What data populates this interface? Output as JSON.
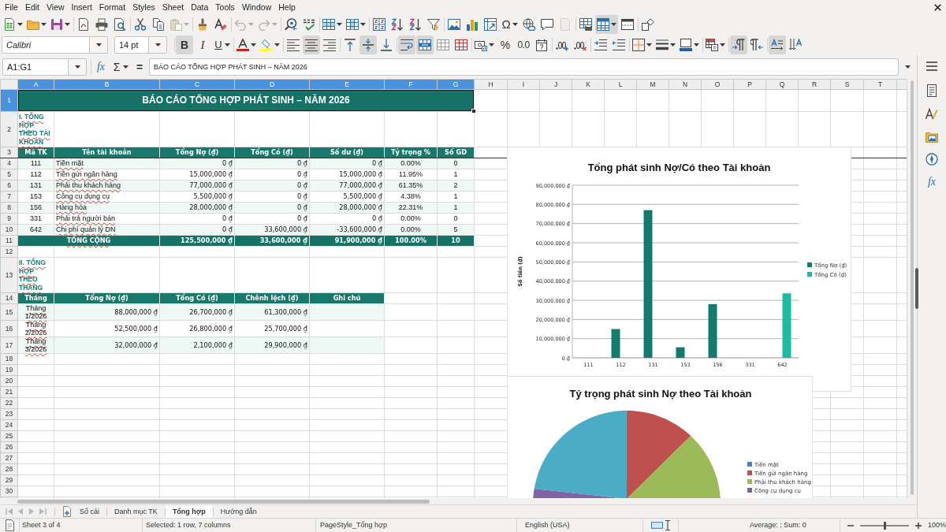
{
  "menu_bar": {
    "items": [
      "File",
      "Edit",
      "View",
      "Insert",
      "Format",
      "Styles",
      "Sheet",
      "Data",
      "Tools",
      "Window",
      "Help"
    ]
  },
  "standard_toolbar": {
    "groups": [
      [
        {
          "kind": "new",
          "dropdown": true,
          "pressed": false,
          "disabled": false
        },
        {
          "kind": "open",
          "dropdown": true,
          "pressed": false,
          "disabled": false
        },
        {
          "kind": "save",
          "dropdown": true,
          "pressed": false,
          "disabled": false
        }
      ],
      [
        {
          "kind": "export_pdf",
          "dropdown": false,
          "pressed": false,
          "disabled": false
        },
        {
          "kind": "print",
          "dropdown": false,
          "pressed": false,
          "disabled": false
        },
        {
          "kind": "print_preview",
          "dropdown": false,
          "pressed": false,
          "disabled": false
        }
      ],
      [
        {
          "kind": "cut",
          "dropdown": false,
          "pressed": false,
          "disabled": false
        },
        {
          "kind": "copy",
          "dropdown": false,
          "pressed": false,
          "disabled": false
        },
        {
          "kind": "paste",
          "dropdown": true,
          "pressed": false,
          "disabled": true
        }
      ],
      [
        {
          "kind": "clone_formatting",
          "dropdown": false,
          "pressed": false,
          "disabled": false
        },
        {
          "kind": "clear_formatting",
          "dropdown": false,
          "pressed": false,
          "disabled": false
        }
      ],
      [
        {
          "kind": "undo",
          "dropdown": true,
          "pressed": false,
          "disabled": true
        },
        {
          "kind": "redo",
          "dropdown": true,
          "pressed": false,
          "disabled": true
        }
      ],
      [
        {
          "kind": "find_replace",
          "dropdown": false,
          "pressed": false,
          "disabled": false
        },
        {
          "kind": "spelling",
          "dropdown": false,
          "pressed": false,
          "disabled": false
        }
      ],
      [
        {
          "kind": "rows",
          "dropdown": true,
          "pressed": false,
          "disabled": false
        },
        {
          "kind": "columns",
          "dropdown": true,
          "pressed": false,
          "disabled": false
        }
      ],
      [
        {
          "kind": "sort",
          "dropdown": false,
          "pressed": false,
          "disabled": false
        },
        {
          "kind": "sort_ascending",
          "dropdown": false,
          "pressed": false,
          "disabled": false
        },
        {
          "kind": "sort_descending",
          "dropdown": false,
          "pressed": false,
          "disabled": false
        },
        {
          "kind": "autofilter",
          "dropdown": false,
          "pressed": false,
          "disabled": false
        }
      ],
      [
        {
          "kind": "image",
          "dropdown": false,
          "pressed": false,
          "disabled": false
        },
        {
          "kind": "chart",
          "dropdown": false,
          "pressed": false,
          "disabled": false
        },
        {
          "kind": "pivot_table",
          "dropdown": false,
          "pressed": false,
          "disabled": false
        },
        {
          "kind": "special_character",
          "label": "Ω",
          "dropdown": true,
          "pressed": false,
          "disabled": false
        },
        {
          "kind": "hyperlink",
          "dropdown": false,
          "pressed": false,
          "disabled": false
        },
        {
          "kind": "comment",
          "dropdown": false,
          "pressed": false,
          "disabled": false
        },
        {
          "kind": "header_footer",
          "dropdown": false,
          "pressed": false,
          "disabled": true
        }
      ],
      [
        {
          "kind": "print_area",
          "dropdown": false,
          "pressed": false,
          "disabled": false
        },
        {
          "kind": "freeze",
          "dropdown": true,
          "pressed": true,
          "disabled": false
        },
        {
          "kind": "split_window",
          "dropdown": false,
          "pressed": false,
          "disabled": false
        }
      ],
      [
        {
          "kind": "shapes",
          "dropdown": false,
          "pressed": false,
          "disabled": false
        }
      ]
    ]
  },
  "formatting_toolbar": {
    "font_name": "Calibri",
    "font_size": "14 pt",
    "groups": [
      [
        {
          "kind": "bold",
          "label": "B",
          "dropdown": false,
          "pressed": true,
          "disabled": false
        },
        {
          "kind": "italic",
          "label": "I",
          "dropdown": false,
          "pressed": false,
          "disabled": false
        },
        {
          "kind": "underline",
          "label": "U",
          "dropdown": true,
          "pressed": false,
          "disabled": false
        }
      ],
      [
        {
          "kind": "font_color",
          "dropdown": true,
          "pressed": false,
          "disabled": false
        },
        {
          "kind": "highlighting",
          "dropdown": true,
          "pressed": false,
          "disabled": false
        }
      ],
      [
        {
          "kind": "align_left",
          "dropdown": false,
          "pressed": false,
          "disabled": false
        },
        {
          "kind": "align_center",
          "dropdown": false,
          "pressed": true,
          "disabled": false
        },
        {
          "kind": "align_right",
          "dropdown": false,
          "pressed": false,
          "disabled": false
        }
      ],
      [
        {
          "kind": "align_top",
          "dropdown": false,
          "pressed": false,
          "disabled": false
        },
        {
          "kind": "align_middle",
          "dropdown": false,
          "pressed": true,
          "disabled": false
        },
        {
          "kind": "align_bottom",
          "dropdown": false,
          "pressed": false,
          "disabled": false
        }
      ],
      [
        {
          "kind": "wrap_text",
          "dropdown": false,
          "pressed": true,
          "disabled": false
        },
        {
          "kind": "merge_and_center",
          "dropdown": false,
          "pressed": true,
          "disabled": false
        },
        {
          "kind": "merge_cells",
          "dropdown": false,
          "pressed": false,
          "disabled": false
        },
        {
          "kind": "unmerge_cells",
          "dropdown": false,
          "pressed": false,
          "disabled": false
        }
      ],
      [
        {
          "kind": "currency",
          "dropdown": true,
          "pressed": false,
          "disabled": false
        },
        {
          "kind": "percent",
          "label": "%",
          "dropdown": false,
          "pressed": false,
          "disabled": false
        },
        {
          "kind": "number",
          "label": "0.0",
          "dropdown": false,
          "pressed": false,
          "disabled": false
        },
        {
          "kind": "date",
          "dropdown": false,
          "pressed": false,
          "disabled": false
        }
      ],
      [
        {
          "kind": "add_decimal",
          "dropdown": false,
          "pressed": false,
          "disabled": false
        },
        {
          "kind": "delete_decimal",
          "dropdown": false,
          "pressed": false,
          "disabled": false
        }
      ],
      [
        {
          "kind": "increase_indent",
          "dropdown": false,
          "pressed": false,
          "disabled": false
        },
        {
          "kind": "decrease_indent",
          "dropdown": false,
          "pressed": false,
          "disabled": false
        }
      ],
      [
        {
          "kind": "borders",
          "dropdown": true,
          "pressed": false,
          "disabled": false
        },
        {
          "kind": "border_style",
          "dropdown": true,
          "pressed": false,
          "disabled": false
        },
        {
          "kind": "border_color",
          "dropdown": true,
          "pressed": false,
          "disabled": false
        }
      ],
      [
        {
          "kind": "conditional",
          "dropdown": true,
          "pressed": false,
          "disabled": false
        }
      ],
      [
        {
          "kind": "left_to_right",
          "dropdown": false,
          "pressed": true,
          "disabled": false
        },
        {
          "kind": "right_to_left",
          "dropdown": false,
          "pressed": false,
          "disabled": false
        }
      ],
      [
        {
          "kind": "text_left_to_right",
          "dropdown": false,
          "pressed": true,
          "disabled": false
        },
        {
          "kind": "text_top_to_bottom",
          "dropdown": false,
          "pressed": false,
          "disabled": false
        }
      ]
    ]
  },
  "formula_bar": {
    "name_box": "A1:G1",
    "buttons": [
      {
        "kind": "function_wizard",
        "label": "fx",
        "dropdown": false
      },
      {
        "kind": "sum",
        "label": "Σ",
        "dropdown": true
      },
      {
        "kind": "formula",
        "label": "=",
        "dropdown": false
      }
    ],
    "content": "BÁO CÁO TỔNG HỢP PHÁT SINH – NĂM 2026"
  },
  "sidebar": {
    "buttons": [
      {
        "kind": "menu"
      },
      {
        "kind": "properties"
      },
      {
        "kind": "styles"
      },
      {
        "kind": "gallery"
      },
      {
        "kind": "navigator"
      },
      {
        "kind": "functions",
        "label": "fx"
      }
    ]
  },
  "sheet": {
    "columns": [
      {
        "label": "A",
        "selected": true
      },
      {
        "label": "B",
        "selected": true
      },
      {
        "label": "C",
        "selected": true
      },
      {
        "label": "D",
        "selected": true
      },
      {
        "label": "E",
        "selected": true
      },
      {
        "label": "F",
        "selected": true
      },
      {
        "label": "G",
        "selected": true
      },
      {
        "label": "H",
        "selected": false
      },
      {
        "label": "I",
        "selected": false
      },
      {
        "label": "J",
        "selected": false
      },
      {
        "label": "K",
        "selected": false
      },
      {
        "label": "L",
        "selected": false
      },
      {
        "label": "M",
        "selected": false
      },
      {
        "label": "N",
        "selected": false
      },
      {
        "label": "O",
        "selected": false
      },
      {
        "label": "P",
        "selected": false
      },
      {
        "label": "Q",
        "selected": false
      },
      {
        "label": "R",
        "selected": false
      },
      {
        "label": "S",
        "selected": false
      },
      {
        "label": "T",
        "selected": false
      }
    ],
    "rows": [
      {
        "label": "1",
        "selected": true
      },
      {
        "label": "2",
        "selected": false
      },
      {
        "label": "3",
        "selected": false
      },
      {
        "label": "4",
        "selected": false
      },
      {
        "label": "5",
        "selected": false
      },
      {
        "label": "6",
        "selected": false
      },
      {
        "label": "7",
        "selected": false
      },
      {
        "label": "8",
        "selected": false
      },
      {
        "label": "9",
        "selected": false
      },
      {
        "label": "10",
        "selected": false
      },
      {
        "label": "11",
        "selected": false
      },
      {
        "label": "12",
        "selected": false
      },
      {
        "label": "13",
        "selected": false
      },
      {
        "label": "14",
        "selected": false
      },
      {
        "label": "15",
        "selected": false
      },
      {
        "label": "16",
        "selected": false
      },
      {
        "label": "17",
        "selected": false
      },
      {
        "label": "18",
        "selected": false
      },
      {
        "label": "19",
        "selected": false
      },
      {
        "label": "20",
        "selected": false
      },
      {
        "label": "21",
        "selected": false
      },
      {
        "label": "22",
        "selected": false
      },
      {
        "label": "23",
        "selected": false
      },
      {
        "label": "24",
        "selected": false
      },
      {
        "label": "25",
        "selected": false
      },
      {
        "label": "26",
        "selected": false
      },
      {
        "label": "27",
        "selected": false
      },
      {
        "label": "28",
        "selected": false
      },
      {
        "label": "29",
        "selected": false
      },
      {
        "label": "30",
        "selected": false
      }
    ],
    "title": {
      "text": "BÁO CÁO TỔNG HỢP PHÁT SINH – NĂM 2026",
      "selected": true
    },
    "tables": [
      {
        "heading": {
          "text": "I. TỔNG HỢP THEO TÀI KHOẢN",
          "spelling_marked": true
        },
        "columns": [
          "Mã TK",
          "Tên tài khoản",
          "Tổng Nợ (₫)",
          "Tổng Có (₫)",
          "Số dư (₫)",
          "Tỷ trọng %",
          "Số GD"
        ],
        "rows": [
          {
            "cells": [
              "111",
              "Tiền mặt",
              "0 ₫",
              "0 ₫",
              "0 ₫",
              "0.00%",
              "0"
            ],
            "banded": true,
            "spelling_marked": true
          },
          {
            "cells": [
              "112",
              "Tiền gửi ngân hàng",
              "15,000,000 ₫",
              "0 ₫",
              "15,000,000 ₫",
              "11.95%",
              "1"
            ],
            "banded": false,
            "spelling_marked": true
          },
          {
            "cells": [
              "131",
              "Phải thu khách hàng",
              "77,000,000 ₫",
              "0 ₫",
              "77,000,000 ₫",
              "61.35%",
              "2"
            ],
            "banded": true,
            "spelling_marked": true
          },
          {
            "cells": [
              "153",
              "Công cụ dụng cụ",
              "5,500,000 ₫",
              "0 ₫",
              "5,500,000 ₫",
              "4.38%",
              "1"
            ],
            "banded": false,
            "spelling_marked": true
          },
          {
            "cells": [
              "156",
              "Hàng hóa",
              "28,000,000 ₫",
              "0 ₫",
              "28,000,000 ₫",
              "22.31%",
              "1"
            ],
            "banded": true,
            "spelling_marked": true
          },
          {
            "cells": [
              "331",
              "Phải trả người bán",
              "0 ₫",
              "0 ₫",
              "0 ₫",
              "0.00%",
              "0"
            ],
            "banded": false,
            "spelling_marked": true
          },
          {
            "cells": [
              "642",
              "Chi phí quản lý DN",
              "0 ₫",
              "33,600,000 ₫",
              "-33,600,000 ₫",
              "0.00%",
              "5"
            ],
            "banded": true,
            "spelling_marked": true
          }
        ],
        "total": {
          "cells": [
            "TỔNG CỘNG",
            "125,500,000 ₫",
            "33,600,000 ₫",
            "91,900,000 ₫",
            "100.00%",
            "10"
          ],
          "spelling_marked": true
        }
      },
      {
        "heading": {
          "text": "II. TỔNG HỢP THEO THÁNG",
          "spelling_marked": true
        },
        "columns": [
          "Tháng",
          "Tổng Nợ (₫)",
          "Tổng Có (₫)",
          "Chênh lệch (₫)",
          "Ghi chú"
        ],
        "rows": [
          {
            "cells": [
              "Tháng 1/2026",
              "88,000,000 ₫",
              "26,700,000 ₫",
              "61,300,000 ₫"
            ],
            "banded": true,
            "spelling_marked": true
          },
          {
            "cells": [
              "Tháng 2/2026",
              "52,500,000 ₫",
              "26,800,000 ₫",
              "25,700,000 ₫"
            ],
            "banded": false,
            "spelling_marked": true
          },
          {
            "cells": [
              "Tháng 3/2026",
              "32,000,000 ₫",
              "2,100,000 ₫",
              "29,900,000 ₫"
            ],
            "banded": true,
            "spelling_marked": true
          }
        ]
      }
    ],
    "bar_chart": {
      "chart_data": {
        "type": "bar",
        "title": "Tổng phát sinh Nợ/Có theo Tài khoản",
        "ylabel": "Số tiền (₫)",
        "categories": [
          "111",
          "112",
          "131",
          "153",
          "156",
          "331",
          "642"
        ],
        "series": [
          {
            "name": "Tổng Nợ (₫)",
            "color": "#137a6e",
            "values": [
              0,
              15000000,
              77000000,
              5500000,
              28000000,
              0,
              0
            ]
          },
          {
            "name": "Tổng Có (₫)",
            "color": "#1cbba2",
            "values": [
              0,
              0,
              0,
              0,
              0,
              0,
              33600000
            ]
          }
        ],
        "ylim": [
          0,
          90000000
        ],
        "yticks": [
          {
            "value": 0,
            "label": "0 ₫"
          },
          {
            "value": 10000000,
            "label": "10,000,000 ₫"
          },
          {
            "value": 20000000,
            "label": "20,000,000 ₫"
          },
          {
            "value": 30000000,
            "label": "30,000,000 ₫"
          },
          {
            "value": 40000000,
            "label": "40,000,000 ₫"
          },
          {
            "value": 50000000,
            "label": "50,000,000 ₫"
          },
          {
            "value": 60000000,
            "label": "60,000,000 ₫"
          },
          {
            "value": 70000000,
            "label": "70,000,000 ₫"
          },
          {
            "value": 80000000,
            "label": "80,000,000 ₫"
          },
          {
            "value": 90000000,
            "label": "90,000,000 ₫"
          }
        ],
        "stacked": false,
        "orientation": "vertical",
        "grid": true,
        "legend": "right"
      }
    },
    "pie_chart": {
      "title": "Tỷ trọng phát sinh Nợ theo Tài khoản",
      "legend": [
        {
          "label": "Tiền mặt",
          "color": "#4f81bd"
        },
        {
          "label": "Tiền gửi ngân hàng",
          "color": "#c0504d"
        },
        {
          "label": "Phải thu khách hàng",
          "color": "#9bbb59"
        },
        {
          "label": "Công cụ dụng cụ",
          "color": "#8064a2"
        }
      ]
    }
  },
  "sheet_tabs": {
    "navigation_disabled": true,
    "tabs": [
      {
        "label": "Sổ cái",
        "selected": false
      },
      {
        "label": "Danh mục TK",
        "selected": false
      },
      {
        "label": "Tổng hợp",
        "selected": true
      },
      {
        "label": "Hướng dẫn",
        "selected": false
      }
    ]
  },
  "status_bar": {
    "sheet_position": "Sheet 3 of 4",
    "selection": "Selected: 1 row, 7 columns",
    "page_style": "PageStyle_Tổng hợp",
    "language": "English (USA)",
    "statistics": "Average: ; Sum: 0",
    "zoom": {
      "level": 0.5,
      "percent": "100%"
    }
  }
}
